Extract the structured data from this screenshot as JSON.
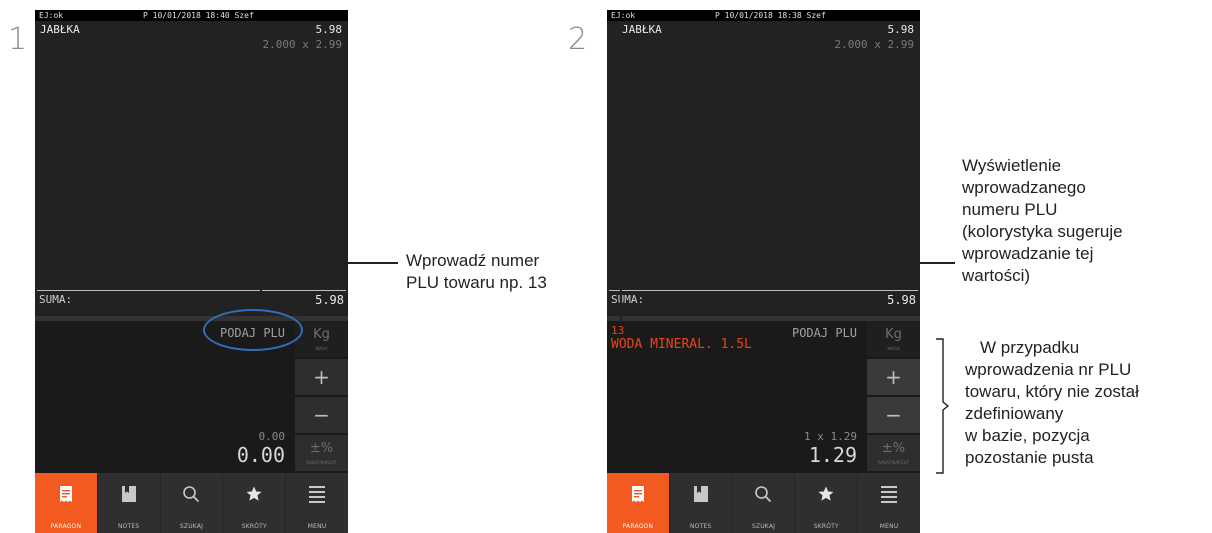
{
  "screens": [
    {
      "step": "1",
      "status": {
        "ej": "EJ:ok",
        "datetime": "P 10/01/2018 18:40 Szef"
      },
      "item": {
        "name": "JABŁKA",
        "price": "5.98",
        "detail": "2.000 x 2.99"
      },
      "sum": {
        "label": "SUMA:",
        "value": "5.98"
      },
      "entry": {
        "prompt": "PODAJ PLU",
        "code": "",
        "name": "",
        "qty": "0.00",
        "total": "0.00"
      }
    },
    {
      "step": "2",
      "status": {
        "ej": "EJ:ok",
        "datetime": "P 10/01/2018 18:38 Szef"
      },
      "item": {
        "name": "JABŁKA",
        "price": "5.98",
        "detail": "2.000 x 2.99"
      },
      "sum": {
        "label": "SUMA:",
        "value": "5.98"
      },
      "entry": {
        "prompt": "PODAJ PLU",
        "code": "13",
        "name": "WODA MINERAL. 1.5L",
        "qty": "1 x 1.29",
        "total": "1.29"
      }
    }
  ],
  "side_buttons": [
    {
      "symbol": "Kg",
      "label": "WAGA"
    },
    {
      "symbol": "+",
      "label": ""
    },
    {
      "symbol": "−",
      "label": ""
    },
    {
      "symbol": "±%",
      "label": "RABAT/NARZUT"
    }
  ],
  "nav": [
    {
      "label": "PARAGON",
      "icon": "receipt-icon"
    },
    {
      "label": "NOTES",
      "icon": "notes-icon"
    },
    {
      "label": "SZUKAJ",
      "icon": "search-icon"
    },
    {
      "label": "SKRÓTY",
      "icon": "star-icon"
    },
    {
      "label": "MENU",
      "icon": "menu-icon"
    }
  ],
  "annotations": {
    "plu_hint": [
      "Wprowadź numer",
      "PLU towaru np. 13"
    ],
    "display_hint": [
      "Wyświetlenie",
      "wprowadzanego",
      "numeru PLU",
      "(kolorystyka sugeruje",
      "wprowadzanie tej",
      "wartości)"
    ],
    "undefined_hint": [
      "W przypadku",
      "wprowadzenia nr PLU",
      "towaru, który nie został",
      "zdefiniowany",
      "w bazie, pozycja",
      "pozostanie pusta"
    ]
  },
  "colors": {
    "accent": "#f25a1f",
    "entry_text": "#e6451c",
    "ellipse": "#2f6fb6"
  }
}
